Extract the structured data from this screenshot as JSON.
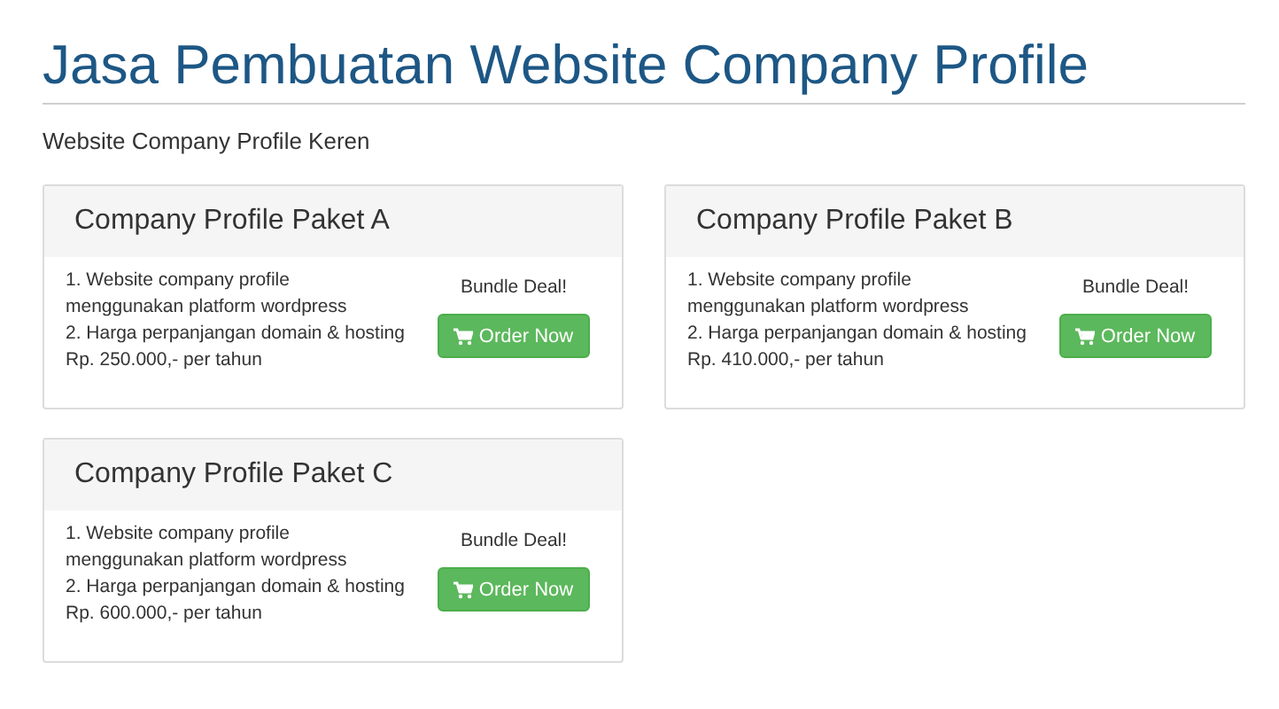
{
  "page": {
    "title": "Jasa Pembuatan Website Company Profile",
    "subtitle": "Website Company Profile Keren"
  },
  "packages": [
    {
      "title": "Company Profile Paket A",
      "features": [
        "1. Website company profile menggunakan platform wordpress",
        "2. Harga perpanjangan domain & hosting Rp. 250.000,- per tahun"
      ],
      "deal": "Bundle Deal!",
      "button": "Order Now"
    },
    {
      "title": "Company Profile Paket B",
      "features": [
        "1. Website company profile menggunakan platform wordpress",
        "2. Harga perpanjangan domain & hosting Rp. 410.000,- per tahun"
      ],
      "deal": "Bundle Deal!",
      "button": "Order Now"
    },
    {
      "title": "Company Profile Paket C",
      "features": [
        "1. Website company profile menggunakan platform wordpress",
        "2. Harga perpanjangan domain & hosting Rp. 600.000,- per tahun"
      ],
      "deal": "Bundle Deal!",
      "button": "Order Now"
    }
  ]
}
